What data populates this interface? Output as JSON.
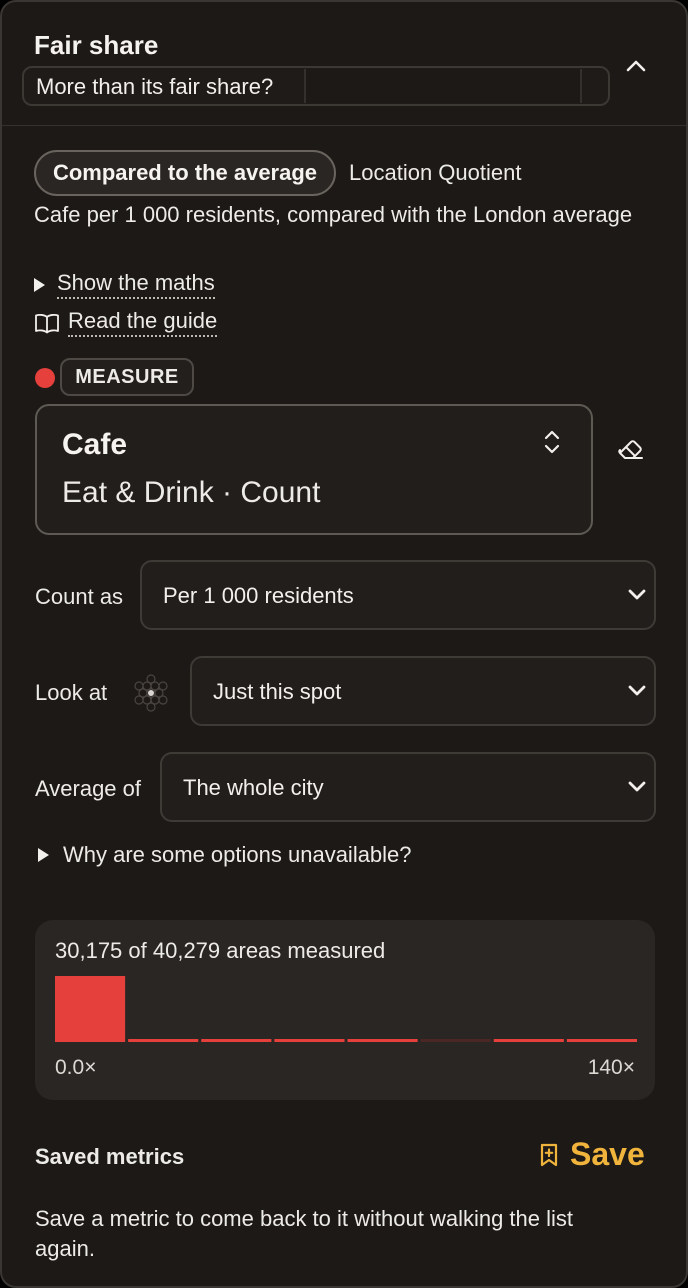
{
  "header": {
    "title": "Fair share",
    "subtitle": "More than its fair share?"
  },
  "mode": {
    "selected": "Compared to the average",
    "alternate": "Location Quotient"
  },
  "description": "Cafe per 1 000 residents, compared with the London average",
  "links": {
    "show_maths": "Show the maths",
    "read_guide": "Read the guide"
  },
  "measure": {
    "badge": "MEASURE",
    "badge_color": "#e5403b",
    "name": "Cafe",
    "subtitle": "Eat & Drink · Count"
  },
  "fields": {
    "count_as": {
      "label": "Count as",
      "value": "Per 1 000 residents"
    },
    "look_at": {
      "label": "Look at",
      "value": "Just this spot"
    },
    "average_of": {
      "label": "Average of",
      "value": "The whole city"
    }
  },
  "why_unavailable": "Why are some options unavailable?",
  "histogram": {
    "summary": "30,175 of 40,279 areas measured",
    "min_label": "0.0×",
    "max_label": "140×"
  },
  "chart_data": {
    "type": "bar",
    "categories": [
      "1",
      "2",
      "3",
      "4",
      "5",
      "6",
      "7",
      "8"
    ],
    "values": [
      100,
      3,
      3,
      3,
      3,
      2,
      3,
      3
    ],
    "xlabel": "",
    "ylabel": "",
    "x_range_labels": [
      "0.0×",
      "140×"
    ],
    "bar_color": "#e5403b",
    "muted_bar_color": "#4a2724",
    "muted_index": 5
  },
  "saved": {
    "label": "Saved metrics",
    "save_label": "Save",
    "save_color": "#f0b43c",
    "description": "Save a metric to come back to it without walking the list again."
  }
}
